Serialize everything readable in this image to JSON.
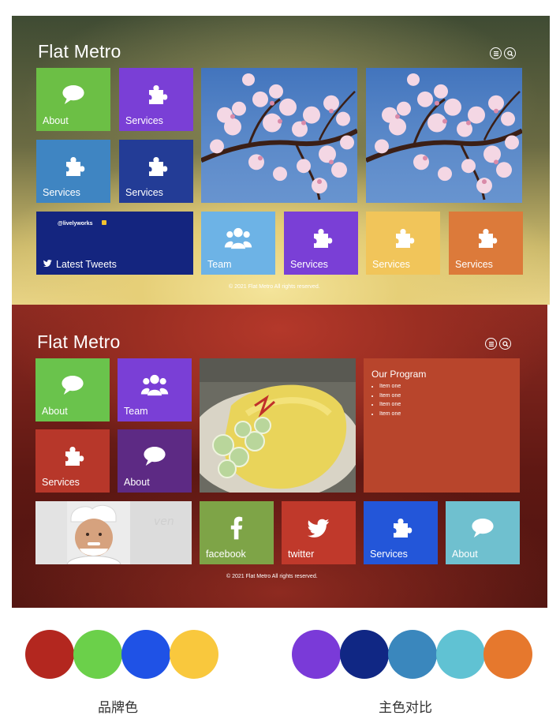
{
  "screen1": {
    "brand": "Flat Metro",
    "header_icons": [
      "menu-icon",
      "search-icon"
    ],
    "tiles": [
      {
        "label": "About",
        "icon": "speech-bubble-icon",
        "color": "#6cbf45"
      },
      {
        "label": "Services",
        "icon": "puzzle-icon",
        "color": "#7a3fd6"
      },
      {
        "label": "Services",
        "icon": "puzzle-icon",
        "color": "#3f85c2"
      },
      {
        "label": "Services",
        "icon": "puzzle-icon",
        "color": "#233c96"
      },
      {
        "label": "Team",
        "icon": "team-icon",
        "color": "#6db3e6"
      },
      {
        "label": "Services",
        "icon": "puzzle-icon",
        "color": "#7a3fd6"
      },
      {
        "label": "Services",
        "icon": "puzzle-icon",
        "color": "#f1c55a"
      },
      {
        "label": "Services",
        "icon": "puzzle-icon",
        "color": "#dc7a3a"
      }
    ],
    "tweets": {
      "handle": "@livelyworks",
      "label": "Latest Tweets",
      "color": "#14257f"
    },
    "photos": [
      "cherry-blossom-photo",
      "cherry-blossom-photo"
    ],
    "footer": "© 2021 Flat Metro All rights reserved."
  },
  "screen2": {
    "brand": "Flat Metro",
    "header_icons": [
      "menu-icon",
      "search-icon"
    ],
    "tiles": [
      {
        "label": "About",
        "icon": "speech-bubble-icon",
        "color": "#6ac34c"
      },
      {
        "label": "Team",
        "icon": "team-icon",
        "color": "#7a3fd6"
      },
      {
        "label": "Services",
        "icon": "puzzle-icon",
        "color": "#b7372a"
      },
      {
        "label": "About",
        "icon": "speech-bubble-icon",
        "color": "#5d2a84"
      },
      {
        "label": "facebook",
        "icon": "facebook-icon",
        "color": "#7ea447"
      },
      {
        "label": "twitter",
        "icon": "twitter-icon",
        "color": "#c0392b"
      },
      {
        "label": "Services",
        "icon": "puzzle-icon",
        "color": "#2356d9"
      },
      {
        "label": "About",
        "icon": "speech-bubble-icon",
        "color": "#6fc0cf"
      }
    ],
    "program": {
      "title": "Our Program",
      "items": [
        "Item one",
        "Item one",
        "Item one",
        "Item one"
      ],
      "color": "#b8452c"
    },
    "photos": [
      "food-omelette-photo",
      "chef-portrait-photo"
    ],
    "footer": "© 2021 Flat Metro All rights reserved."
  },
  "palettes": [
    {
      "caption": "品牌色",
      "colors": [
        "#b3271f",
        "#6bd04a",
        "#1f52e6",
        "#f9c83d"
      ]
    },
    {
      "caption": "主色对比",
      "colors": [
        "#7a3ad8",
        "#102784",
        "#3a87bd",
        "#60c2d3",
        "#e6782d"
      ]
    }
  ]
}
